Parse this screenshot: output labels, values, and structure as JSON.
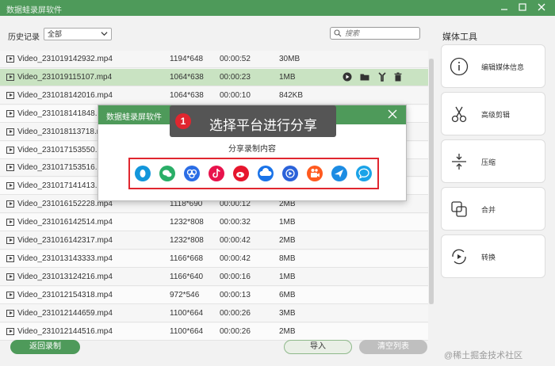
{
  "window": {
    "title": "数据蛙录屏软件"
  },
  "toolbar": {
    "history_label": "历史记录",
    "filter_value": "全部",
    "search_placeholder": "搜索"
  },
  "files": [
    {
      "name": "Video_231019142932.mp4",
      "resolution": "1194*648",
      "duration": "00:00:52",
      "size": "30MB"
    },
    {
      "name": "Video_231019115107.mp4",
      "resolution": "1064*638",
      "duration": "00:00:23",
      "size": "1MB"
    },
    {
      "name": "Video_231018142016.mp4",
      "resolution": "1064*638",
      "duration": "00:00:10",
      "size": "842KB"
    },
    {
      "name": "Video_231018141848.mp4",
      "resolution": "",
      "duration": "",
      "size": ""
    },
    {
      "name": "Video_231018113718.mp4",
      "resolution": "",
      "duration": "",
      "size": ""
    },
    {
      "name": "Video_231017153550.mp4",
      "resolution": "",
      "duration": "",
      "size": ""
    },
    {
      "name": "Video_231017153516.mp4",
      "resolution": "",
      "duration": "",
      "size": ""
    },
    {
      "name": "Video_231017141413.mp4",
      "resolution": "",
      "duration": "",
      "size": ""
    },
    {
      "name": "Video_231016152228.mp4",
      "resolution": "1118*690",
      "duration": "00:00:12",
      "size": "2MB"
    },
    {
      "name": "Video_231016142514.mp4",
      "resolution": "1232*808",
      "duration": "00:00:32",
      "size": "1MB"
    },
    {
      "name": "Video_231016142317.mp4",
      "resolution": "1232*808",
      "duration": "00:00:42",
      "size": "2MB"
    },
    {
      "name": "Video_231013143333.mp4",
      "resolution": "1166*668",
      "duration": "00:00:42",
      "size": "8MB"
    },
    {
      "name": "Video_231013124216.mp4",
      "resolution": "1166*640",
      "duration": "00:00:16",
      "size": "1MB"
    },
    {
      "name": "Video_231012154318.mp4",
      "resolution": "972*546",
      "duration": "00:00:13",
      "size": "6MB"
    },
    {
      "name": "Video_231012144659.mp4",
      "resolution": "1100*664",
      "duration": "00:00:26",
      "size": "3MB"
    },
    {
      "name": "Video_231012144516.mp4",
      "resolution": "1100*664",
      "duration": "00:00:26",
      "size": "2MB"
    }
  ],
  "sidebar": {
    "title": "媒体工具",
    "tools": [
      {
        "label": "编辑媒体信息",
        "icon": "info-icon"
      },
      {
        "label": "高级剪辑",
        "icon": "scissors-icon"
      },
      {
        "label": "压缩",
        "icon": "compress-icon"
      },
      {
        "label": "合并",
        "icon": "merge-icon"
      },
      {
        "label": "转换",
        "icon": "convert-icon"
      }
    ]
  },
  "footer": {
    "back_label": "返回录制",
    "import_label": "导入",
    "clear_label": "清空列表",
    "watermark": "@稀土掘金技术社区"
  },
  "dialog": {
    "title": "数据蛙录屏软件",
    "subtitle": "分享录制内容",
    "platforms": [
      {
        "name": "qq-icon",
        "color": "#1296db"
      },
      {
        "name": "wechat-icon",
        "color": "#2aae67"
      },
      {
        "name": "baidu-netdisk-icon",
        "color": "#2b6de5"
      },
      {
        "name": "douyin-icon",
        "color": "#e8134c"
      },
      {
        "name": "weibo-icon",
        "color": "#e6162d"
      },
      {
        "name": "cloud-icon",
        "color": "#1a73e8"
      },
      {
        "name": "video-play-icon",
        "color": "#2b62d9"
      },
      {
        "name": "kuaishou-icon",
        "color": "#ff5a1f"
      },
      {
        "name": "bird-icon",
        "color": "#1c8ce3"
      },
      {
        "name": "chat-bubble-icon",
        "color": "#1aa3e8"
      }
    ]
  },
  "annotation": {
    "badge": "1",
    "text": "选择平台进行分享"
  },
  "colors": {
    "accent": "#4e9a5a",
    "selected_row": "#c9e3c2",
    "highlight": "#e0262f"
  }
}
